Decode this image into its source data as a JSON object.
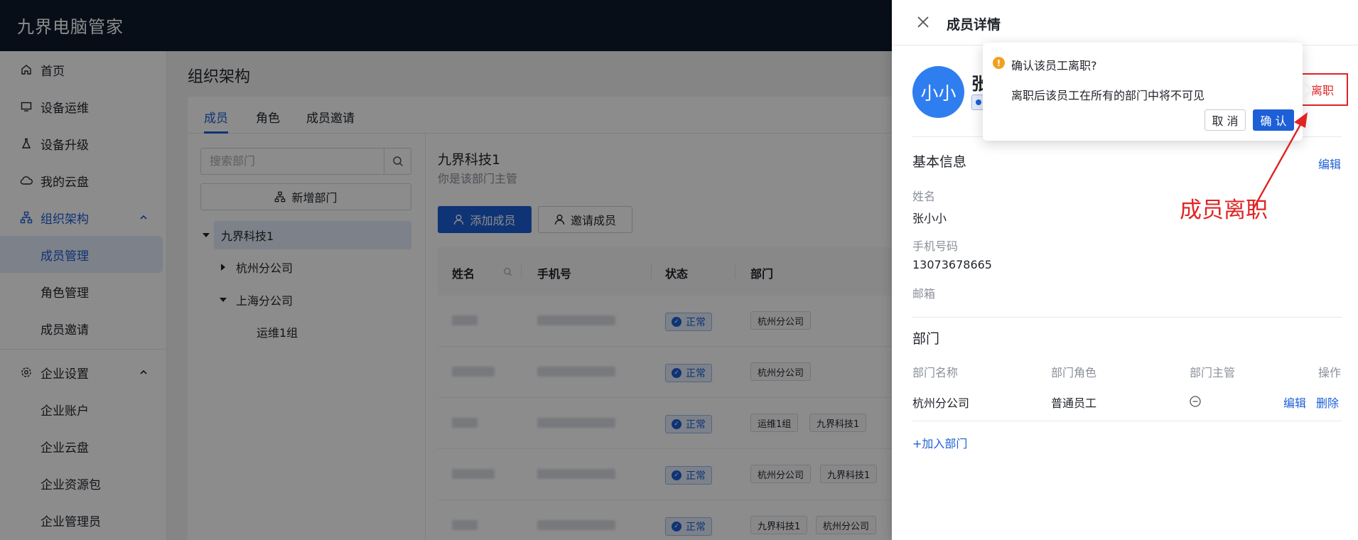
{
  "app": {
    "title": "九界电脑管家"
  },
  "sidebar": {
    "items": [
      {
        "label": "首页",
        "icon": "home-icon"
      },
      {
        "label": "设备运维",
        "icon": "monitor-icon"
      },
      {
        "label": "设备升级",
        "icon": "flask-icon"
      },
      {
        "label": "我的云盘",
        "icon": "cloud-icon"
      },
      {
        "label": "组织架构",
        "icon": "org-icon",
        "expanded": true,
        "children": [
          {
            "label": "成员管理",
            "active": true
          },
          {
            "label": "角色管理"
          },
          {
            "label": "成员邀请"
          }
        ]
      },
      {
        "label": "企业设置",
        "icon": "gear-icon",
        "expanded": true,
        "children": [
          {
            "label": "企业账户"
          },
          {
            "label": "企业云盘"
          },
          {
            "label": "企业资源包"
          },
          {
            "label": "企业管理员"
          }
        ]
      }
    ]
  },
  "main": {
    "page_title": "组织架构",
    "tabs": [
      {
        "label": "成员",
        "active": true
      },
      {
        "label": "角色"
      },
      {
        "label": "成员邀请"
      }
    ],
    "dept_search": {
      "placeholder": "搜索部门"
    },
    "add_dept_label": "新增部门",
    "tree": [
      {
        "label": "九界科技1",
        "expanded": true,
        "selected": true
      },
      {
        "label": "杭州分公司",
        "expanded": false
      },
      {
        "label": "上海分公司",
        "expanded": true
      },
      {
        "label": "运维1组"
      }
    ],
    "dept_header": {
      "name": "九界科技1",
      "subtitle": "你是该部门主管"
    },
    "add_member_label": "添加成员",
    "invite_member_label": "邀请成员",
    "table": {
      "columns": [
        "姓名",
        "手机号",
        "状态",
        "部门"
      ],
      "rows": [
        {
          "status": "正常",
          "depts": [
            "杭州分公司"
          ]
        },
        {
          "status": "正常",
          "depts": [
            "杭州分公司"
          ]
        },
        {
          "status": "正常",
          "depts": [
            "运维1组",
            "九界科技1"
          ]
        },
        {
          "status": "正常",
          "depts": [
            "杭州分公司",
            "九界科技1"
          ]
        },
        {
          "status": "正常",
          "depts": [
            "九界科技1",
            "杭州分公司"
          ]
        }
      ]
    }
  },
  "drawer": {
    "title": "成员详情",
    "avatar_text": "小小",
    "name_visible": "张",
    "leave_label": "离职",
    "basic_info_title": "基本信息",
    "edit_label": "编辑",
    "fields": [
      {
        "label": "姓名",
        "value": "张小小"
      },
      {
        "label": "手机号码",
        "value": "13073678665"
      },
      {
        "label": "邮箱",
        "value": ""
      }
    ],
    "dept_section_title": "部门",
    "dept_columns": [
      "部门名称",
      "部门角色",
      "部门主管",
      "操作"
    ],
    "dept_rows": [
      {
        "name": "杭州分公司",
        "role": "普通员工",
        "edit": "编辑",
        "delete": "删除"
      }
    ],
    "add_dept_link": "+加入部门"
  },
  "popconfirm": {
    "title": "确认该员工离职?",
    "description": "离职后该员工在所有的部门中将不可见",
    "cancel_label": "取 消",
    "confirm_label": "确 认"
  },
  "annotation": {
    "text": "成员离职"
  },
  "colors": {
    "primary": "#1d5fd6",
    "topbar": "#0e1a2c",
    "annotation": "#e02424",
    "warning": "#f0a020"
  }
}
